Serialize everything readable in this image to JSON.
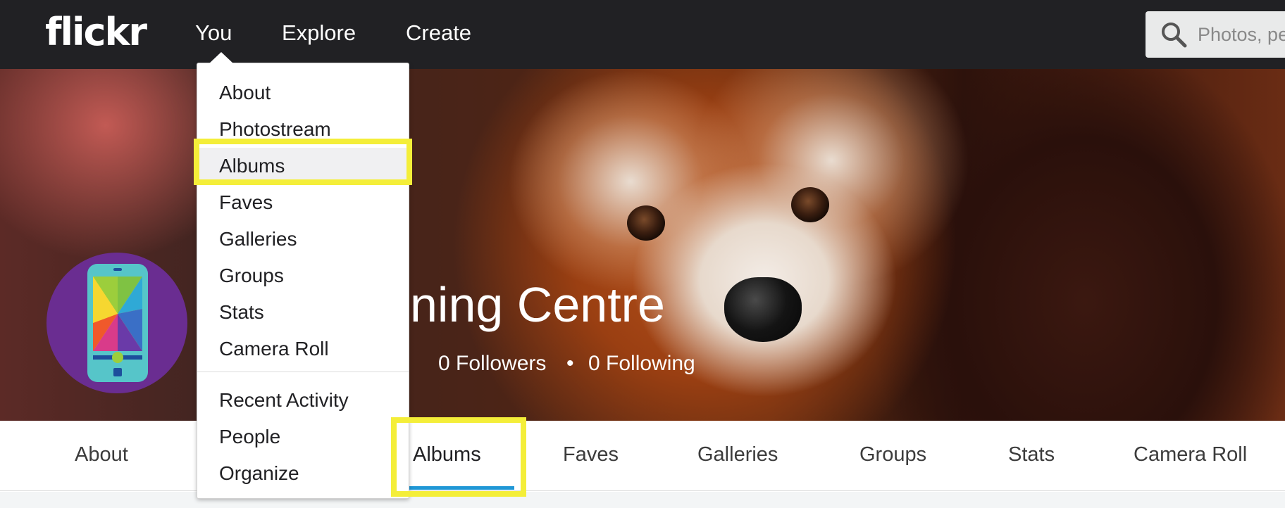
{
  "nav": {
    "logo": "flickr",
    "items": [
      "You",
      "Explore",
      "Create"
    ],
    "search_placeholder": "Photos, pe"
  },
  "you_menu": {
    "items": [
      "About",
      "Photostream",
      "Albums",
      "Faves",
      "Galleries",
      "Groups",
      "Stats",
      "Camera Roll"
    ],
    "secondary_items": [
      "Recent Activity",
      "People",
      "Organize"
    ],
    "highlighted": "Albums"
  },
  "profile": {
    "name_visible": "ning Centre",
    "followers": "0 Followers",
    "separator": "•",
    "following": "0 Following"
  },
  "profile_tabs": {
    "items": [
      "About",
      "Albums",
      "Faves",
      "Galleries",
      "Groups",
      "Stats",
      "Camera Roll"
    ],
    "active": "Albums"
  },
  "colors": {
    "nav_background": "#212124",
    "annotation_highlight": "#f4ee39",
    "active_tab_underline": "#1f97d6",
    "avatar_background": "#6a2d91"
  }
}
